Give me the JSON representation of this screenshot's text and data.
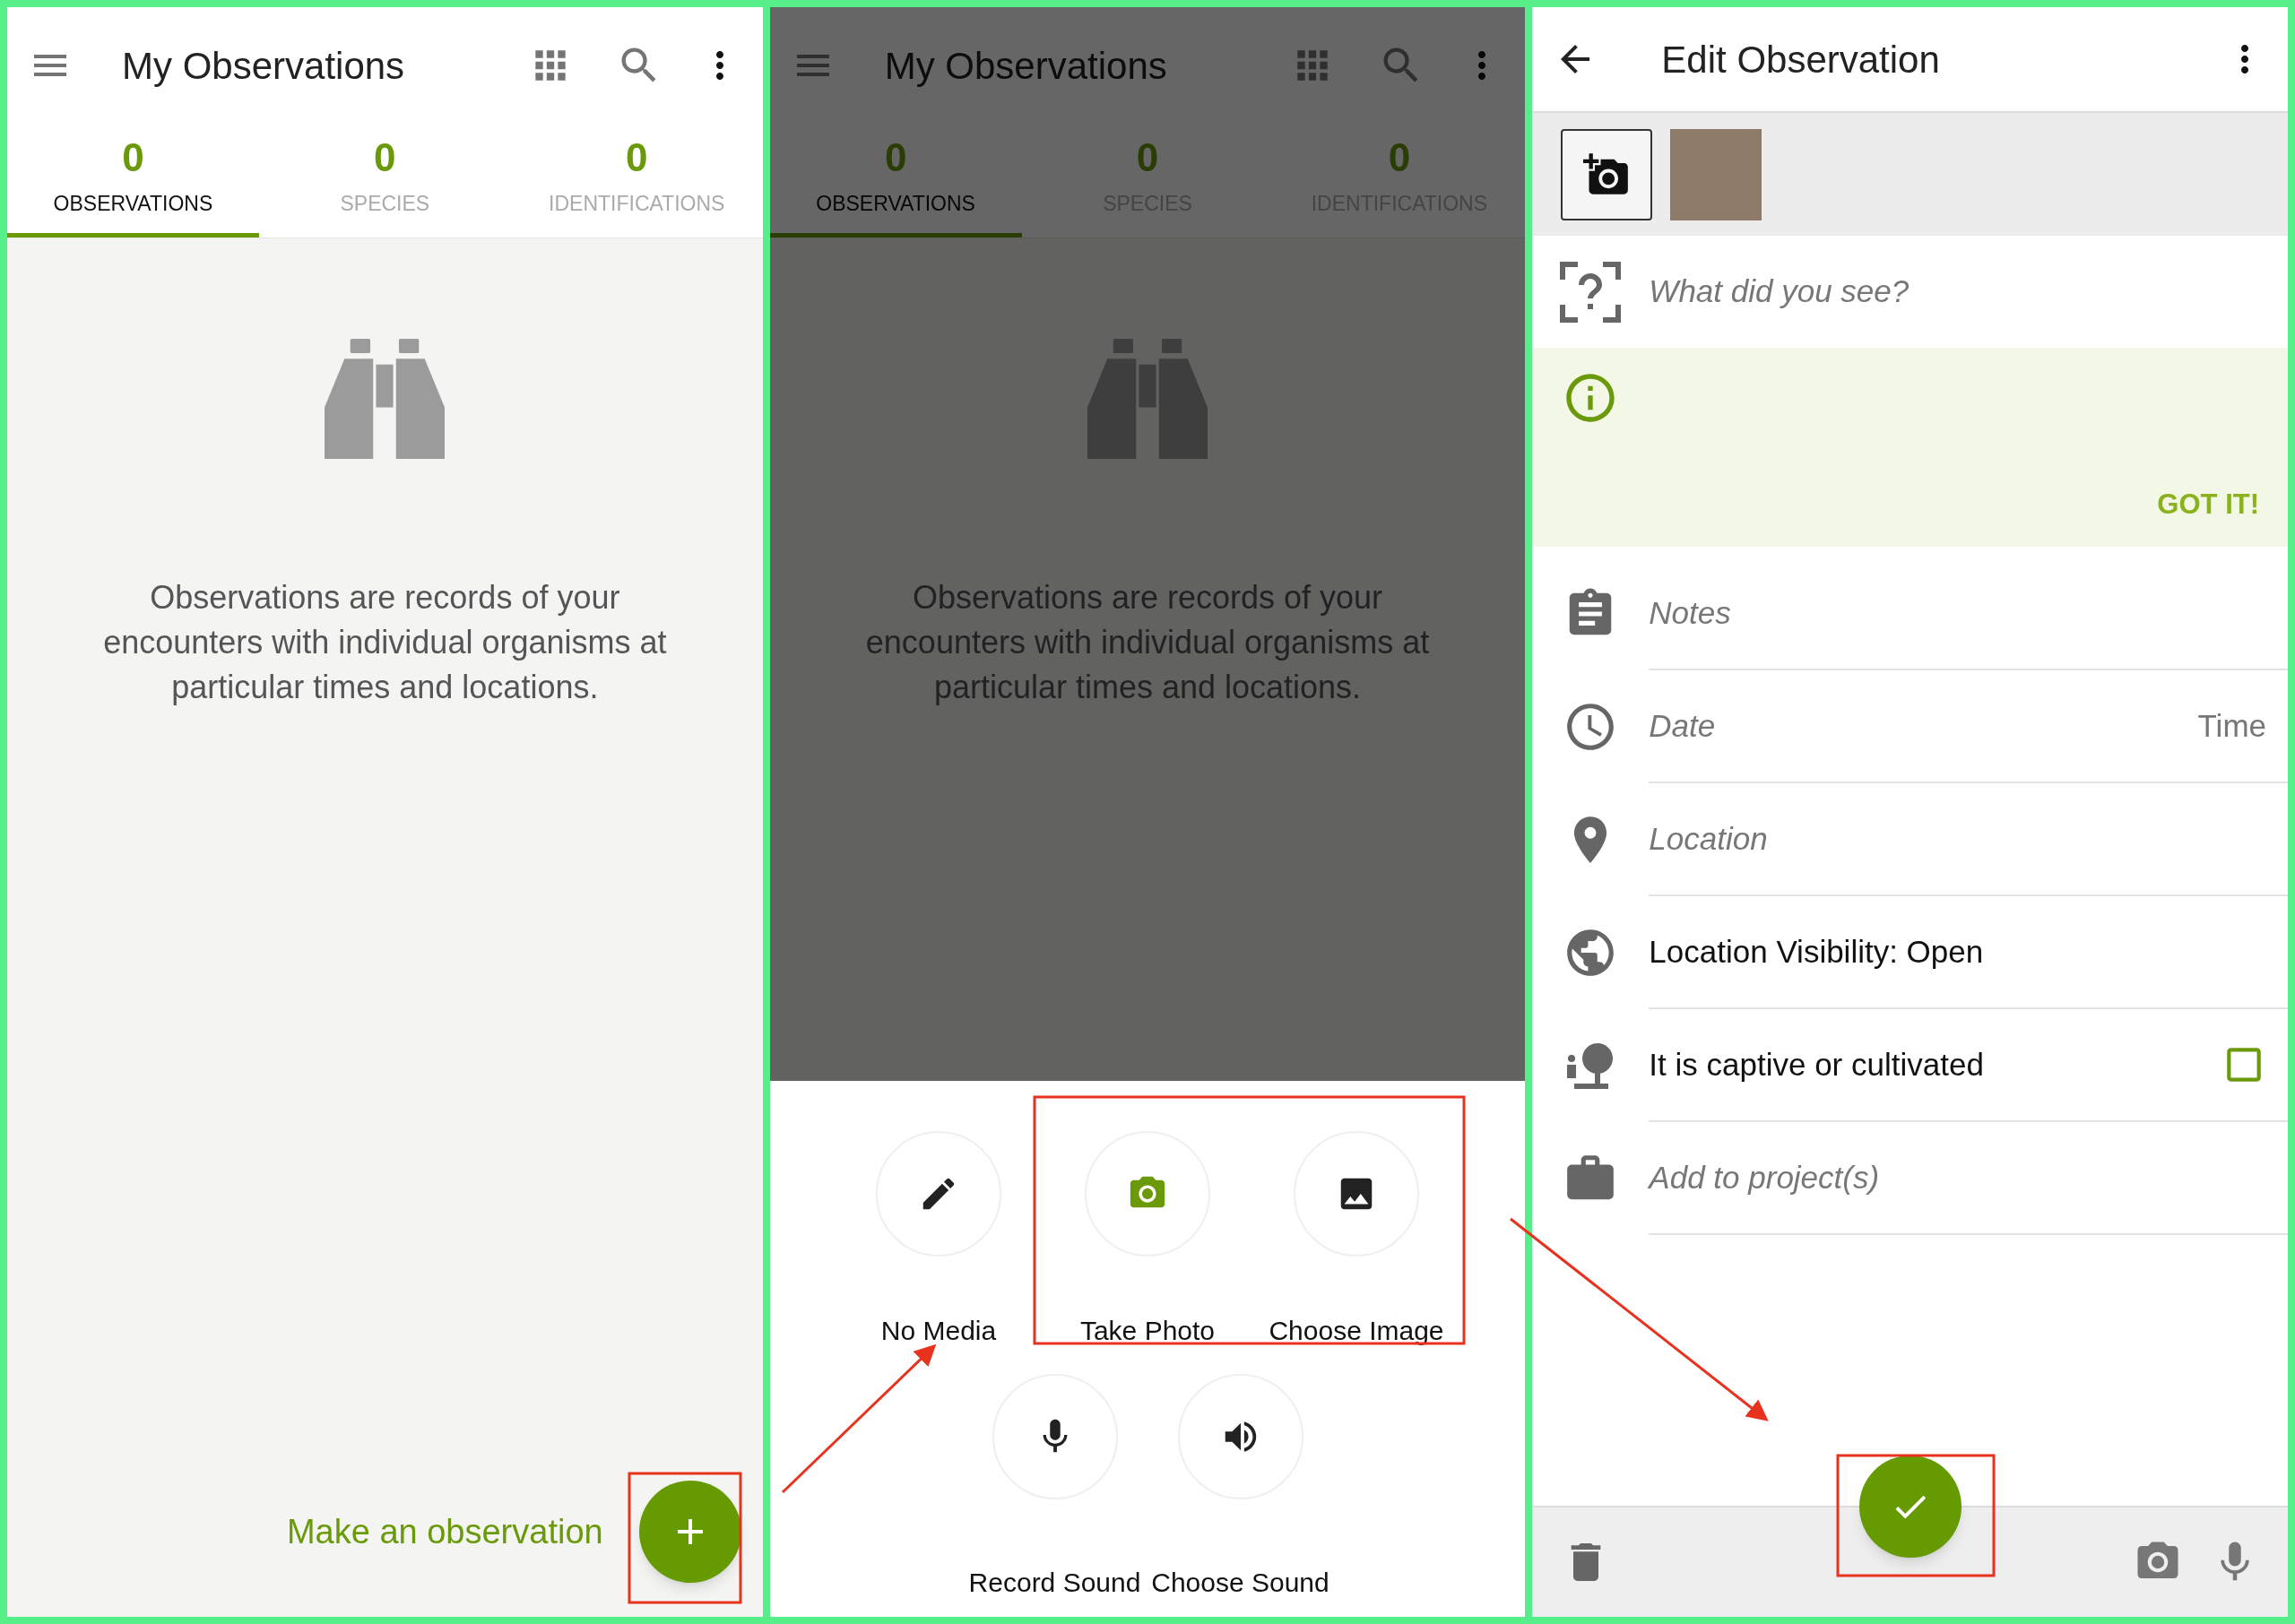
{
  "observations_screen": {
    "title": "My Observations",
    "tabs": [
      {
        "count": "0",
        "label": "OBSERVATIONS",
        "selected": true
      },
      {
        "count": "0",
        "label": "SPECIES",
        "selected": false
      },
      {
        "count": "0",
        "label": "IDENTIFICATIONS",
        "selected": false
      }
    ],
    "empty_message": "Observations are records of your encounters with individual organisms at particular times and locations.",
    "action_label": "Make an observation"
  },
  "media_screen": {
    "title": "My Observations",
    "tabs": [
      {
        "count": "0",
        "label": "OBSERVATIONS",
        "selected": true
      },
      {
        "count": "0",
        "label": "SPECIES",
        "selected": false
      },
      {
        "count": "0",
        "label": "IDENTIFICATIONS",
        "selected": false
      }
    ],
    "empty_message": "Observations are records of your encounters with individual organisms at particular times and locations.",
    "options": [
      {
        "kind": "none",
        "label": "No Media"
      },
      {
        "kind": "photo",
        "label": "Take Photo"
      },
      {
        "kind": "image",
        "label": "Choose Image"
      },
      {
        "kind": "record",
        "label": "Record Sound"
      },
      {
        "kind": "sound",
        "label": "Choose Sound"
      }
    ]
  },
  "edit_screen": {
    "title": "Edit Observation",
    "species_placeholder": "What did you see?",
    "tip_action": "GOT IT!",
    "fields": [
      {
        "kind": "notes",
        "placeholder": "Notes"
      },
      {
        "kind": "date",
        "placeholder": "Date",
        "trailing": "Time"
      },
      {
        "kind": "location",
        "placeholder": "Location"
      },
      {
        "kind": "visibility",
        "value": "Location Visibility: Open"
      },
      {
        "kind": "captive",
        "value": "It is captive or cultivated",
        "checked": false
      },
      {
        "kind": "projects",
        "placeholder": "Add to project(s)"
      }
    ]
  }
}
